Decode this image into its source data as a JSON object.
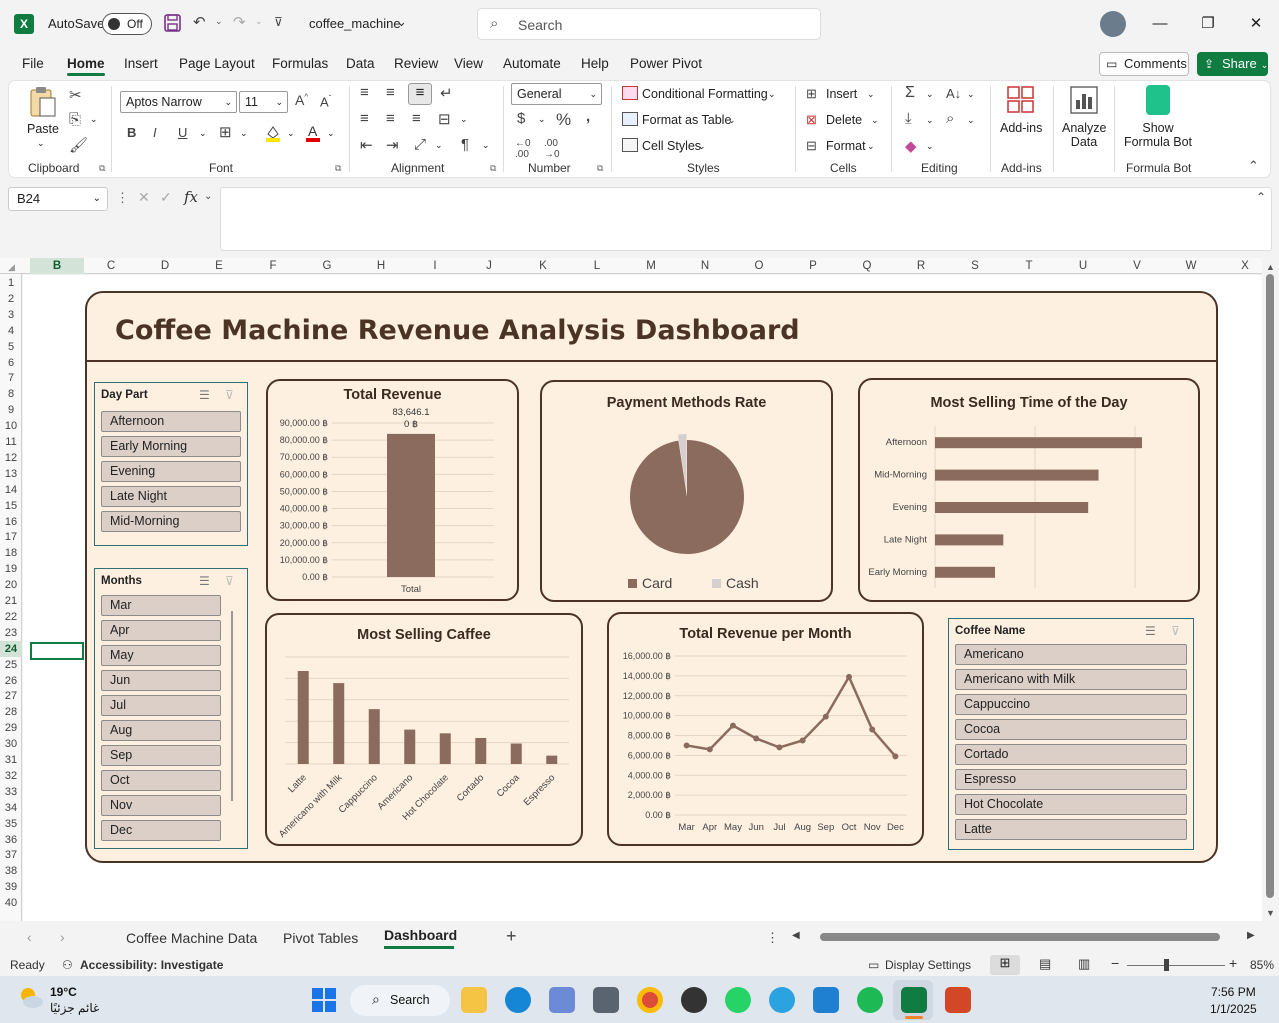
{
  "titlebar": {
    "autosave_label": "AutoSave",
    "autosave_state": "Off",
    "filename": "coffee_machine",
    "search_placeholder": "Search"
  },
  "menu": {
    "items": [
      "File",
      "Home",
      "Insert",
      "Page Layout",
      "Formulas",
      "Data",
      "Review",
      "View",
      "Automate",
      "Help",
      "Power Pivot"
    ],
    "active": "Home",
    "comments": "Comments",
    "share": "Share"
  },
  "ribbon": {
    "paste": "Paste",
    "font_name": "Aptos Narrow",
    "font_size": "11",
    "number_format": "General",
    "conditional_formatting": "Conditional Formatting",
    "format_as_table": "Format as Table",
    "cell_styles": "Cell Styles",
    "insert": "Insert",
    "delete": "Delete",
    "format": "Format",
    "add_ins": "Add-ins",
    "analyze_data_1": "Analyze",
    "analyze_data_2": "Data",
    "formula_bot_1": "Show",
    "formula_bot_2": "Formula Bot",
    "groups": {
      "clipboard": "Clipboard",
      "font": "Font",
      "alignment": "Alignment",
      "number": "Number",
      "styles": "Styles",
      "cells": "Cells",
      "editing": "Editing",
      "add_ins": "Add-ins",
      "formula_bot": "Formula Bot"
    }
  },
  "formula_bar": {
    "name_box": "B24",
    "fx": "fx",
    "value": ""
  },
  "grid": {
    "columns": [
      "B",
      "C",
      "D",
      "E",
      "F",
      "G",
      "H",
      "I",
      "J",
      "K",
      "L",
      "M",
      "N",
      "O",
      "P",
      "Q",
      "R",
      "S",
      "T",
      "U",
      "V",
      "W",
      "X"
    ],
    "rows": [
      "1",
      "2",
      "3",
      "4",
      "5",
      "6",
      "7",
      "8",
      "9",
      "10",
      "11",
      "12",
      "13",
      "14",
      "15",
      "16",
      "17",
      "18",
      "19",
      "20",
      "21",
      "22",
      "23",
      "24",
      "25",
      "26",
      "27",
      "28",
      "29",
      "30",
      "31",
      "32",
      "33",
      "34",
      "35",
      "36",
      "37",
      "38",
      "39",
      "40"
    ]
  },
  "dashboard": {
    "title": "Coffee Machine Revenue Analysis Dashboard",
    "slicers": {
      "day_part": {
        "title": "Day Part",
        "items": [
          "Afternoon",
          "Early Morning",
          "Evening",
          "Late Night",
          "Mid-Morning"
        ]
      },
      "months": {
        "title": "Months",
        "items": [
          "Mar",
          "Apr",
          "May",
          "Jun",
          "Jul",
          "Aug",
          "Sep",
          "Oct",
          "Nov",
          "Dec"
        ]
      },
      "coffee_name": {
        "title": "Coffee Name",
        "items": [
          "Americano",
          "Americano with Milk",
          "Cappuccino",
          "Cocoa",
          "Cortado",
          "Espresso",
          "Hot Chocolate",
          "Latte"
        ]
      }
    }
  },
  "chart_data": [
    {
      "type": "bar",
      "title": "Total Revenue",
      "categories": [
        "Total"
      ],
      "values": [
        83646.1
      ],
      "data_label_lines": [
        "83,646.1",
        "0 ฿"
      ],
      "ylim": [
        0,
        90000
      ],
      "yticks": [
        "0.00 ฿",
        "10,000.00 ฿",
        "20,000.00 ฿",
        "30,000.00 ฿",
        "40,000.00 ฿",
        "50,000.00 ฿",
        "60,000.00 ฿",
        "70,000.00 ฿",
        "80,000.00 ฿",
        "90,000.00 ฿"
      ],
      "color": "#8c6b5f"
    },
    {
      "type": "pie",
      "title": "Payment Methods Rate",
      "categories": [
        "Card",
        "Cash"
      ],
      "values": [
        97.6,
        2.4
      ],
      "colors": [
        "#8c6b5f",
        "#d6cfd0"
      ],
      "legend": "bottom"
    },
    {
      "type": "bar",
      "orientation": "horizontal",
      "title": "Most Selling Time of the Day",
      "categories": [
        "Afternoon",
        "Mid-Morning",
        "Evening",
        "Late Night",
        "Early Morning"
      ],
      "values": [
        100,
        79,
        74,
        33,
        29
      ],
      "color": "#8c6b5f"
    },
    {
      "type": "bar",
      "title": "Most Selling Caffee",
      "categories": [
        "Latte",
        "Americano with Milk",
        "Cappuccino",
        "Americano",
        "Hot Chocolate",
        "Cortado",
        "Cocoa",
        "Espresso"
      ],
      "values": [
        100,
        87,
        59,
        37,
        33,
        28,
        22,
        9
      ],
      "color": "#8c6b5f"
    },
    {
      "type": "line",
      "title": "Total Revenue per Month",
      "categories": [
        "Mar",
        "Apr",
        "May",
        "Jun",
        "Jul",
        "Aug",
        "Sep",
        "Oct",
        "Nov",
        "Dec"
      ],
      "values": [
        7000,
        6600,
        9000,
        7700,
        6800,
        7500,
        9900,
        13900,
        8600,
        5900
      ],
      "ylim": [
        0,
        16000
      ],
      "yticks": [
        "0.00 ฿",
        "2,000.00 ฿",
        "4,000.00 ฿",
        "6,000.00 ฿",
        "8,000.00 ฿",
        "10,000.00 ฿",
        "12,000.00 ฿",
        "14,000.00 ฿",
        "16,000.00 ฿"
      ],
      "color": "#8c6b5f"
    }
  ],
  "sheet_tabs": {
    "tabs": [
      "Coffee Machine Data",
      "Pivot Tables",
      "Dashboard"
    ],
    "active": "Dashboard"
  },
  "status": {
    "ready": "Ready",
    "accessibility": "Accessibility: Investigate",
    "display_settings": "Display Settings",
    "zoom": "85%"
  },
  "taskbar": {
    "weather_temp": "19°C",
    "weather_desc": "غائم جزئيًا",
    "search": "Search",
    "time": "7:56 PM",
    "date": "1/1/2025"
  }
}
